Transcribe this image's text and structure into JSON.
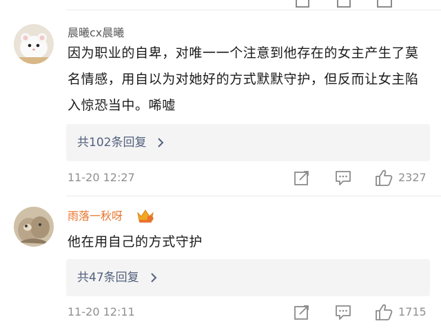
{
  "comments": [
    {
      "username": "晨曦cx晨曦",
      "text": "因为职业的自卑，对唯一一个注意到他存在的女主产生了莫名情感，用自以为对她好的方式默默守护，但反而让女主陷入惊恐当中。唏嘘",
      "replies_label": "共102条回复",
      "time": "11-20 12:27",
      "likes": "2327",
      "avatar_icon": "hamster-avatar-icon"
    },
    {
      "username": "雨落一秋呀",
      "text": "他在用自己的方式守护",
      "replies_label": "共47条回复",
      "time": "11-20 12:11",
      "likes": "1715",
      "avatar_icon": "kitten-avatar-icon",
      "badge_icon": "crown-vip-icon"
    }
  ],
  "colors": {
    "link": "#52607d",
    "vip_name": "#e8742c",
    "meta": "#8f8f8f"
  }
}
